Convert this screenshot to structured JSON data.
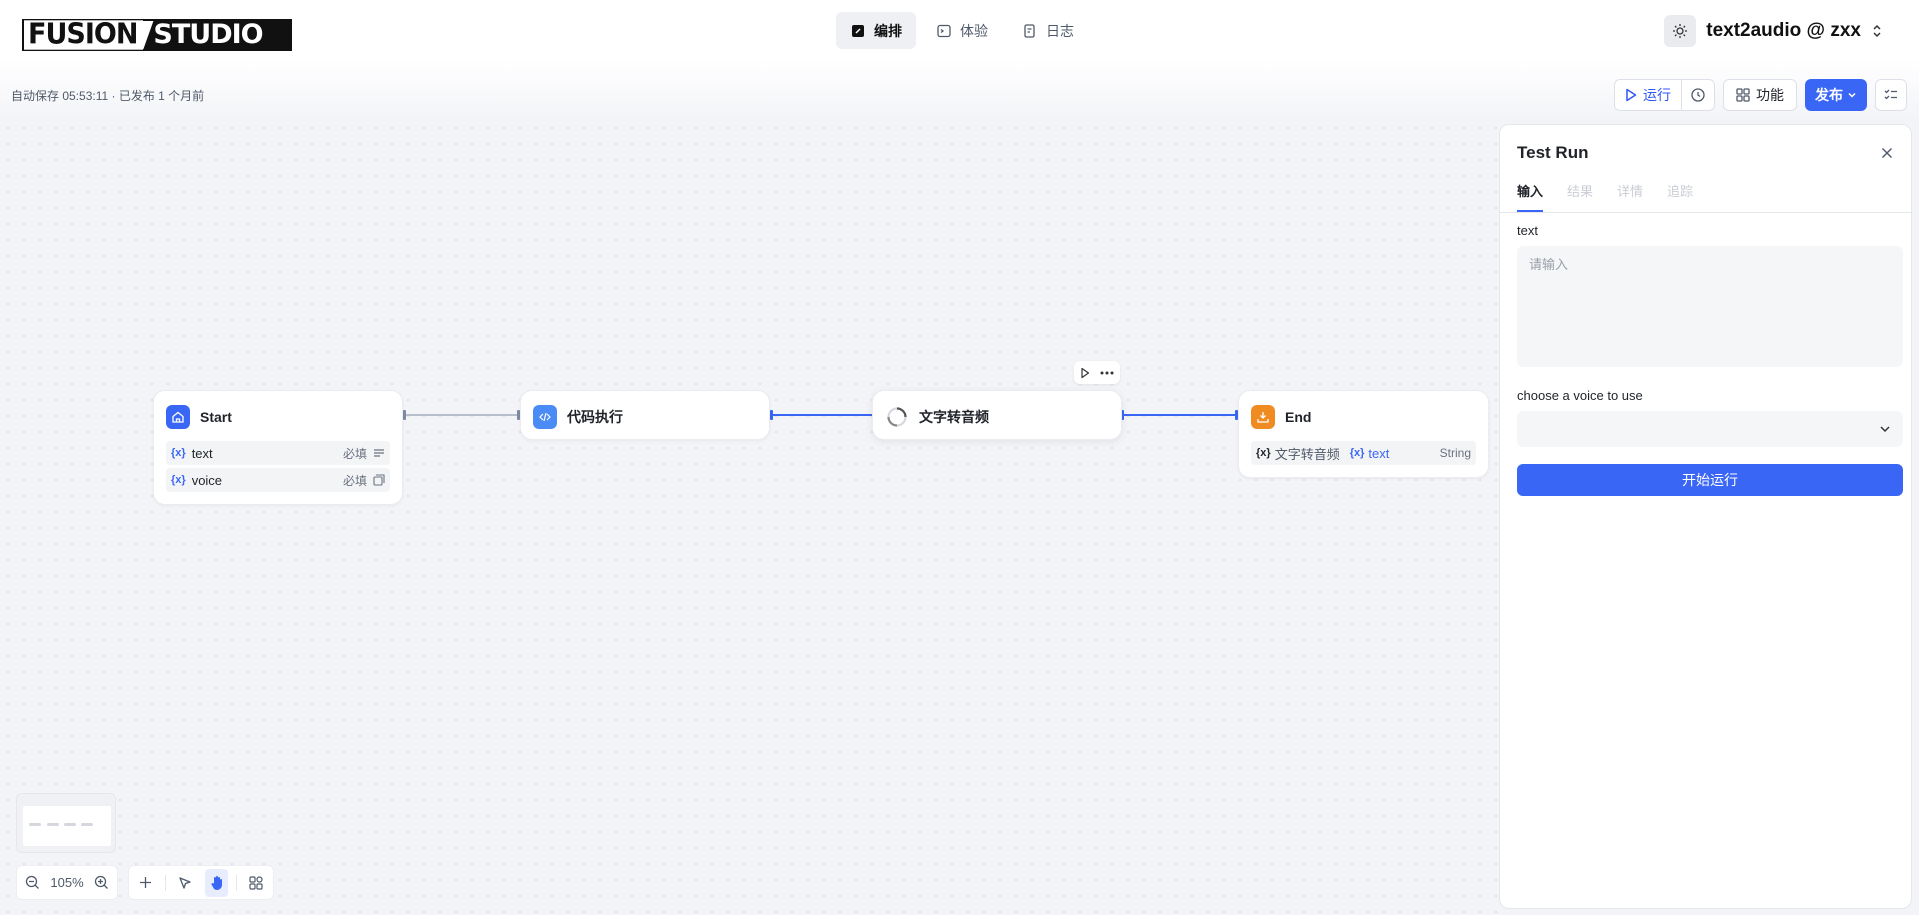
{
  "header": {
    "logo_left": "FUSION",
    "logo_right": "STUDIO",
    "tabs": [
      {
        "label": "编排",
        "icon": "edit-icon",
        "active": true
      },
      {
        "label": "体验",
        "icon": "terminal-icon",
        "active": false
      },
      {
        "label": "日志",
        "icon": "log-icon",
        "active": false
      }
    ],
    "app_name": "text2audio @ zxx"
  },
  "subbar": {
    "autosave": "自动保存 05:53:11 · 已发布 1 个月前",
    "run_label": "运行",
    "feature_label": "功能",
    "publish_label": "发布"
  },
  "nodes": {
    "start": {
      "title": "Start",
      "rows": [
        {
          "var": "{x}",
          "name": "text",
          "req": "必填"
        },
        {
          "var": "{x}",
          "name": "voice",
          "req": "必填"
        }
      ]
    },
    "code": {
      "title": "代码执行"
    },
    "tts": {
      "title": "文字转音频"
    },
    "end": {
      "title": "End",
      "row": {
        "source": "文字转音频",
        "var": "{x}",
        "name": "text",
        "type": "String"
      }
    }
  },
  "panel": {
    "title": "Test Run",
    "tabs": [
      {
        "label": "输入",
        "active": true
      },
      {
        "label": "结果",
        "active": false
      },
      {
        "label": "详情",
        "active": false
      },
      {
        "label": "追踪",
        "active": false
      }
    ],
    "text_label": "text",
    "text_placeholder": "请输入",
    "voice_label": "choose a voice to use",
    "run_button": "开始运行"
  },
  "controls": {
    "zoom": "105%"
  },
  "colors": {
    "accent": "#3a66f6",
    "start_icon": "#3a66f6",
    "code_icon": "#4a8bf5",
    "end_icon": "#f08b22"
  }
}
